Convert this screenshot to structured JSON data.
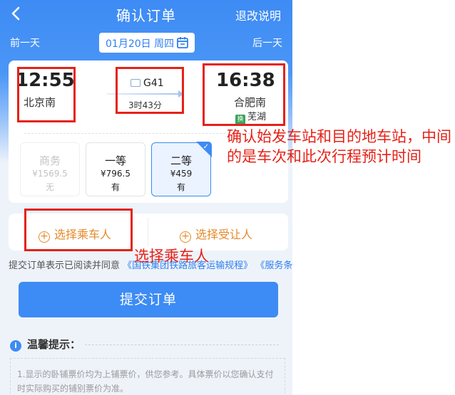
{
  "header": {
    "title": "确认订单",
    "refund_label": "退改说明",
    "prev_day": "前一天",
    "next_day": "后一天",
    "date": "01月20日 周四"
  },
  "trip": {
    "departure_time": "12:55",
    "departure_station": "北京南",
    "arrival_time": "16:38",
    "arrival_station": "合肥南",
    "arrival_sub_tag": "换",
    "arrival_sub_station": "芜湖",
    "train_number": "G41",
    "duration": "3时43分"
  },
  "seats": [
    {
      "name": "商务",
      "price": "¥1569.5",
      "status": "无"
    },
    {
      "name": "一等",
      "price": "¥796.5",
      "status": "有"
    },
    {
      "name": "二等",
      "price": "¥459",
      "status": "有"
    }
  ],
  "passengers": {
    "select_passenger": "选择乘车人",
    "select_beneficiary": "选择受让人"
  },
  "agreement": {
    "prefix": "提交订单表示已阅读并同意",
    "link1": "《国铁集团铁路旅客运输规程》",
    "link2": "《服务条款》"
  },
  "submit_label": "提交订单",
  "tips": {
    "title": "温馨提示：",
    "text": "1.显示的卧铺票价均为上铺票价，供您参考。具体票价以您确认支付时实际购买的铺别票价为准。"
  },
  "annotations": {
    "note_trip": "确认始发车站和目的地车站，中间的是车次和此次行程预计时间",
    "note_passenger": "选择乘车人"
  },
  "colors": {
    "primary": "#3d8bf4",
    "accent_orange": "#e58a2a",
    "annotation_red": "#e62117"
  }
}
